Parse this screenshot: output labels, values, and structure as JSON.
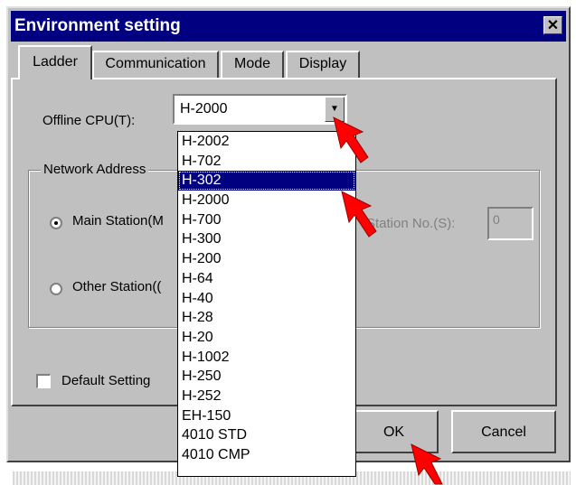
{
  "window": {
    "title": "Environment setting",
    "close_label": "✕"
  },
  "tabs": [
    {
      "label": "Ladder",
      "active": true
    },
    {
      "label": "Communication",
      "active": false
    },
    {
      "label": "Mode",
      "active": false
    },
    {
      "label": "Display",
      "active": false
    }
  ],
  "offline_cpu": {
    "label": "Offline CPU(T):",
    "value": "H-2000"
  },
  "network": {
    "group_label": "Network Address",
    "main_station_label": "Main Station(M",
    "other_station_label": "Other Station((",
    "station_no_label": "Station No.(S):",
    "station_no_value": "0"
  },
  "default_setting_label": "Default Setting",
  "buttons": {
    "ok": "OK",
    "cancel": "Cancel"
  },
  "dropdown_options": [
    "H-2002",
    "H-702",
    "H-302",
    "H-2000",
    "H-700",
    "H-300",
    "H-200",
    "H-64",
    "H-40",
    "H-28",
    "H-20",
    "H-1002",
    "H-250",
    "H-252",
    "EH-150",
    "4010 STD",
    "4010 CMP"
  ],
  "dropdown_selected": "H-302",
  "colors": {
    "title_bar": "#000080",
    "face": "#c0c0c0",
    "highlight": "#000080",
    "pointer": "#ff0000"
  }
}
